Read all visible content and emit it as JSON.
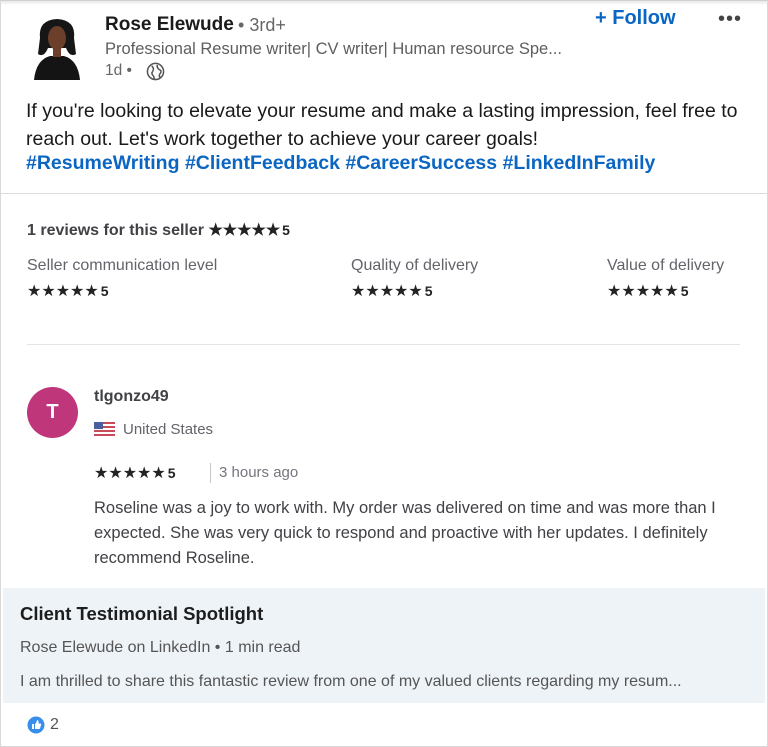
{
  "post": {
    "author": {
      "name": "Rose Elewude",
      "degree": "3rd+",
      "headline": "Professional Resume writer| CV writer| Human resource Spe...",
      "time": "1d •",
      "follow_label": "+ Follow",
      "more_label": "•••"
    },
    "text": "If you're looking to elevate your resume and make a lasting impression, feel free to reach out. Let's work together to achieve your career goals!",
    "hashtags": [
      "#ResumeWriting",
      "#ClientFeedback",
      "#CareerSuccess",
      "#LinkedInFamily"
    ]
  },
  "review_card": {
    "summary_label": "1 reviews for this seller",
    "summary_score": "5",
    "stars_glyph": "★★★★★",
    "categories": [
      {
        "label": "Seller communication level",
        "score": "5"
      },
      {
        "label": "Quality of delivery",
        "score": "5"
      },
      {
        "label": "Value of delivery",
        "score": "5"
      }
    ],
    "review": {
      "avatar_letter": "T",
      "username": "tlgonzo49",
      "country": "United States",
      "score": "5",
      "time": "3 hours ago",
      "text": "Roseline was a joy to work with. My order was delivered on time and was more than I expected. She was very quick to respond and proactive with her updates. I definitely recommend Roseline."
    }
  },
  "article": {
    "title": "Client Testimonial Spotlight",
    "meta": "Rose Elewude on LinkedIn • 1 min read",
    "description": "I am thrilled to share this fantastic review from one of my valued clients regarding my resum..."
  },
  "reactions": {
    "count": "2"
  },
  "colors": {
    "accent": "#0a66c2",
    "avatar_bg": "#c0367a",
    "article_bg": "#eef3f8"
  },
  "icons": [
    "globe-icon",
    "like-icon",
    "us-flag-icon",
    "more-icon"
  ]
}
